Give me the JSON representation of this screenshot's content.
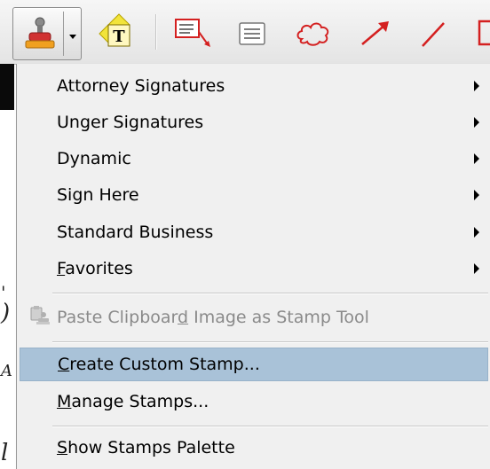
{
  "toolbar": {
    "icons": [
      "stamp-icon",
      "dropdown-arrow-icon",
      "text-highlight-icon",
      "text-callout-icon",
      "text-box-icon",
      "cloud-icon",
      "arrow-icon",
      "line-icon",
      "rectangle-icon"
    ],
    "colors": {
      "annotation_red": "#d42020",
      "highlight_yellow": "#f2e43a"
    }
  },
  "menu": {
    "submenus": [
      {
        "label": "Attorney Signatures"
      },
      {
        "label": "Unger Signatures"
      },
      {
        "label": "Dynamic"
      },
      {
        "label": "Sign Here"
      },
      {
        "label": "Standard Business"
      },
      {
        "label_mnemonic": "F",
        "label_rest": "avorites"
      }
    ],
    "paste": {
      "label_pre": "Paste Clipboar",
      "label_mnemonic": "d",
      "label_post": " Image as Stamp Tool",
      "icon": "paste-stamp-icon",
      "enabled": false
    },
    "create": {
      "label_mnemonic": "C",
      "label_rest": "reate Custom Stamp...",
      "highlighted": true
    },
    "manage": {
      "label_mnemonic": "M",
      "label_rest": "anage Stamps..."
    },
    "palette": {
      "label_mnemonic": "S",
      "label_rest": "how Stamps Palette"
    }
  },
  "colors": {
    "menu_bg": "#f0f0f0",
    "highlight_bg": "#a9c2d8",
    "disabled_text": "#8a8a8a"
  }
}
